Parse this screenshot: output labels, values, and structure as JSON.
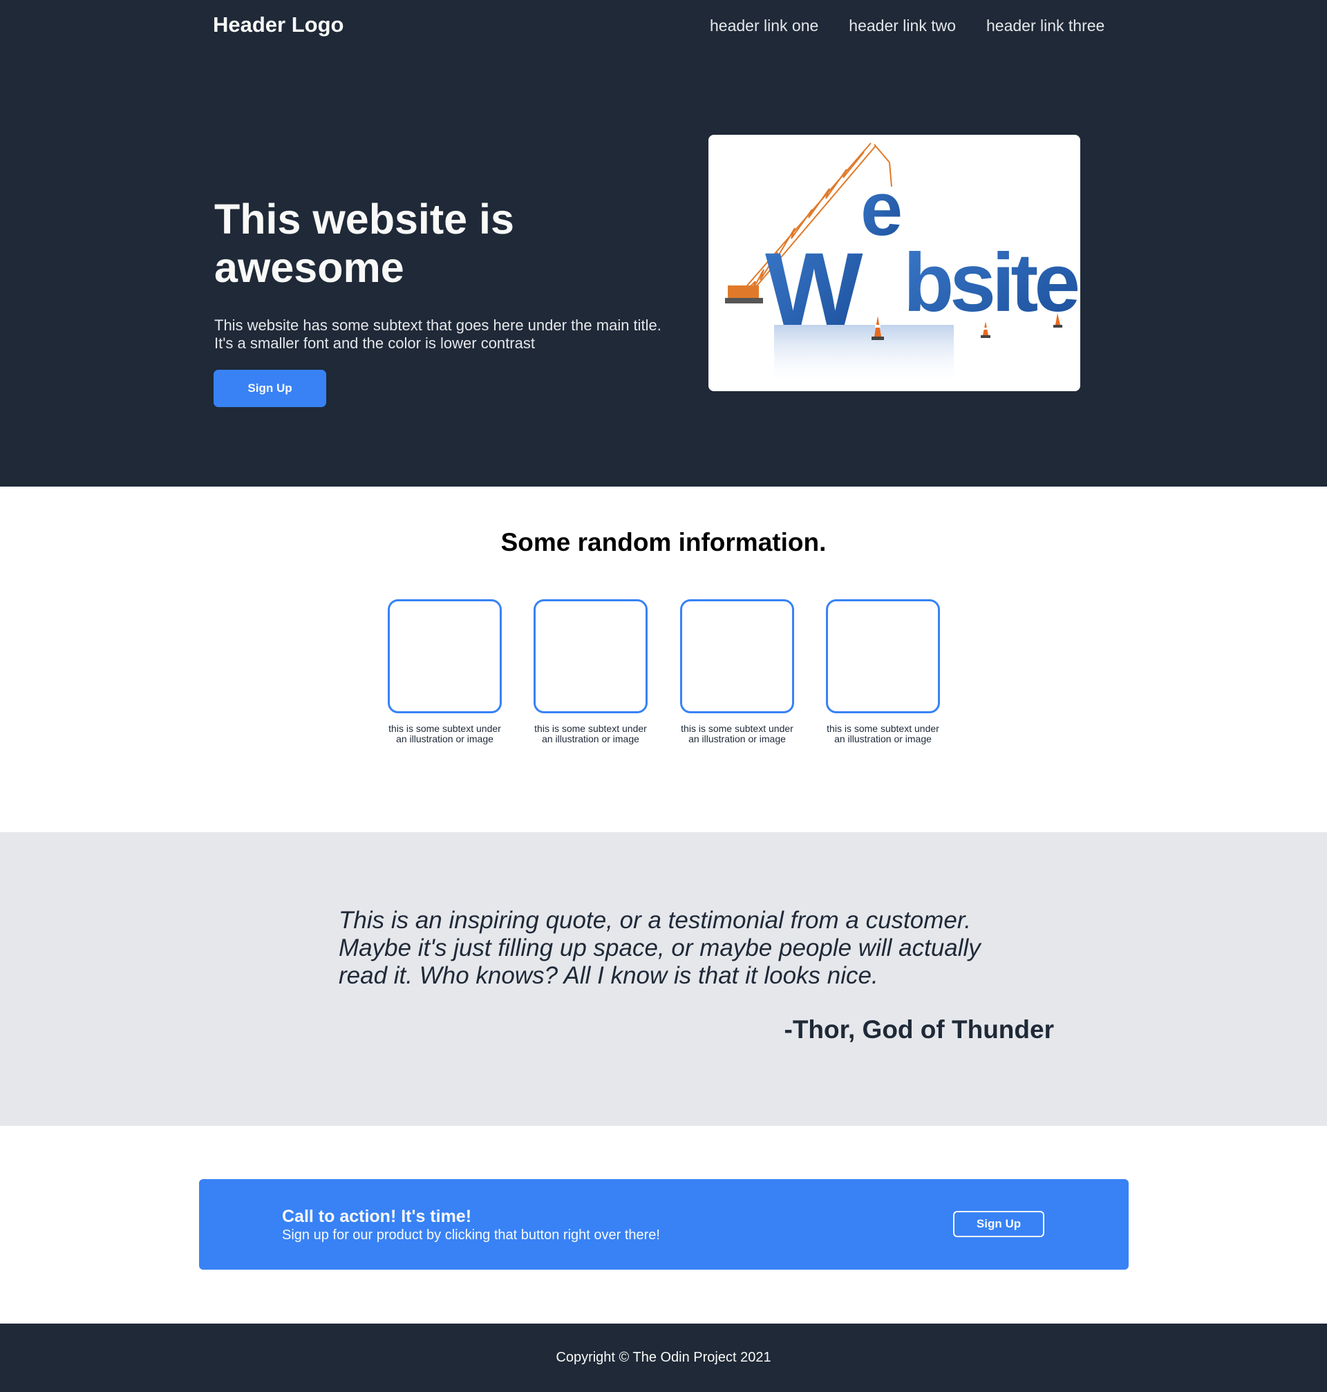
{
  "colors": {
    "dark": "#1f2937",
    "accent": "#3882f6",
    "light_text": "#f9faf8",
    "muted_text": "#e5e7eb",
    "quote_bg": "#e5e7eb"
  },
  "header": {
    "logo": "Header Logo",
    "nav": [
      "header link one",
      "header link two",
      "header link three"
    ]
  },
  "hero": {
    "title": "This website is awesome",
    "subtitle_lines": [
      "This website has some subtext that goes here under the main title.",
      "It's a smaller font and the color is lower contrast"
    ],
    "button_label": "Sign Up",
    "image_icon": "website-construction-illustration"
  },
  "info": {
    "title": "Some random information.",
    "cards": [
      {
        "caption_lines": [
          "this is some subtext under",
          "an illustration or image"
        ]
      },
      {
        "caption_lines": [
          "this is some subtext under",
          "an illustration or image"
        ]
      },
      {
        "caption_lines": [
          "this is some subtext under",
          "an illustration or image"
        ]
      },
      {
        "caption_lines": [
          "this is some subtext under",
          "an illustration or image"
        ]
      }
    ]
  },
  "quote": {
    "lines": [
      "This is an inspiring quote, or a testimonial from a customer.",
      "Maybe it's just filling up space, or maybe people will actually",
      "read it. Who knows? All I know is that it looks nice."
    ],
    "author": "-Thor, God of Thunder"
  },
  "cta": {
    "title": "Call to action! It's time!",
    "subtitle": "Sign up for our product by clicking that button right over there!",
    "button_label": "Sign Up"
  },
  "footer": {
    "text": "Copyright © The Odin Project 2021"
  }
}
